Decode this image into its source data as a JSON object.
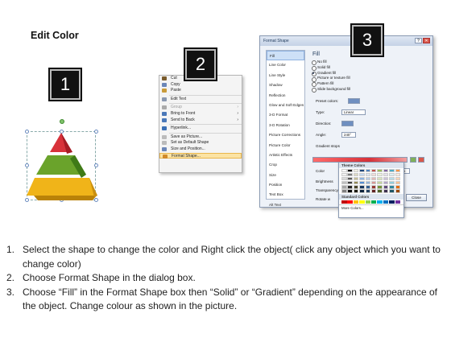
{
  "title": "Edit Color",
  "badges": [
    "1",
    "2",
    "3"
  ],
  "context_menu": {
    "items": [
      {
        "label": "Cut",
        "color": "#7a5c2e"
      },
      {
        "label": "Copy",
        "color": "#6b86b8"
      },
      {
        "label": "Paste",
        "color": "#c99b3a"
      },
      {
        "sep": true
      },
      {
        "label": "Edit Text",
        "color": "#8a98b0"
      },
      {
        "sep": true
      },
      {
        "label": "Group",
        "disabled": true,
        "arrow": true,
        "color": "#aaaaaa"
      },
      {
        "label": "Bring to Front",
        "arrow": true,
        "color": "#4a78b8"
      },
      {
        "label": "Send to Back",
        "arrow": true,
        "color": "#4a78b8"
      },
      {
        "sep": true
      },
      {
        "label": "Hyperlink...",
        "color": "#3a6fb5"
      },
      {
        "sep": true
      },
      {
        "label": "Save as Picture...",
        "color": "#bbbbbb"
      },
      {
        "label": "Set as Default Shape",
        "color": "#bbbbbb"
      },
      {
        "label": "Size and Position...",
        "color": "#6b86b8"
      },
      {
        "label": "Format Shape...",
        "highlight": true,
        "color": "#d08a2a"
      }
    ]
  },
  "dialog": {
    "title": "Format Shape",
    "sidebar": [
      "Fill",
      "Line Color",
      "Line Style",
      "Shadow",
      "Reflection",
      "Glow and Soft Edges",
      "3-D Format",
      "3-D Rotation",
      "Picture Corrections",
      "Picture Color",
      "Artistic Effects",
      "Crop",
      "Size",
      "Position",
      "Text Box",
      "Alt Text"
    ],
    "fill_heading": "Fill",
    "options": [
      {
        "label": "No fill",
        "on": false
      },
      {
        "label": "Solid fill",
        "on": false
      },
      {
        "label": "Gradient fill",
        "on": true
      },
      {
        "label": "Picture or texture fill",
        "on": false
      },
      {
        "label": "Pattern fill",
        "on": false
      },
      {
        "label": "Slide background fill",
        "on": false
      }
    ],
    "preset_label": "Preset colors:",
    "type_label": "Type:",
    "type_value": "Linear",
    "direction_label": "Direction:",
    "angle_label": "Angle:",
    "angle_value": "240°",
    "stops_label": "Gradient stops",
    "color_label": "Color",
    "position_label": "Position:",
    "position_value": "100%",
    "brightness_label": "Brightness",
    "transparency_label": "Transparency",
    "rotate_label": "Rotate w",
    "close_label": "Close"
  },
  "palette": {
    "theme_heading": "Theme Colors",
    "theme_rows": [
      [
        "#ffffff",
        "#000000",
        "#eeece1",
        "#1f497d",
        "#4f81bd",
        "#c0504d",
        "#9bbb59",
        "#8064a2",
        "#4bacc6",
        "#f79646"
      ],
      [
        "#f2f2f2",
        "#7f7f7f",
        "#ddd9c3",
        "#c6d9f0",
        "#dbe5f1",
        "#f2dcdb",
        "#ebf1dd",
        "#e5e0ec",
        "#dbeef3",
        "#fdeada"
      ],
      [
        "#d8d8d8",
        "#595959",
        "#c4bd97",
        "#8db3e2",
        "#b8cce4",
        "#e5b9b7",
        "#d7e3bc",
        "#ccc1d9",
        "#b7dde8",
        "#fbd5b5"
      ],
      [
        "#bfbfbf",
        "#3f3f3f",
        "#938953",
        "#548dd4",
        "#95b3d7",
        "#d99694",
        "#c3d69b",
        "#b2a2c7",
        "#92cddc",
        "#fac08f"
      ],
      [
        "#a5a5a5",
        "#262626",
        "#494429",
        "#17365d",
        "#366092",
        "#953734",
        "#76923c",
        "#5f497a",
        "#31859b",
        "#e36c09"
      ],
      [
        "#7f7f7f",
        "#0c0c0c",
        "#1d1b10",
        "#0f243e",
        "#244061",
        "#632423",
        "#4f6128",
        "#3f3151",
        "#205867",
        "#974806"
      ]
    ],
    "standard_heading": "Standard Colors",
    "standard": [
      "#c00000",
      "#ff0000",
      "#ffc000",
      "#ffff00",
      "#92d050",
      "#00b050",
      "#00b0f0",
      "#0070c0",
      "#002060",
      "#7030a0"
    ],
    "more_label": "More Colors..."
  },
  "pyramid_colors": {
    "top": "#d8323a",
    "middle": "#6aa32b",
    "bottom": "#f0b419"
  },
  "steps": [
    {
      "n": "1.",
      "text": "Select the shape to change the color and Right click the object( click any object which you want to change color)"
    },
    {
      "n": "2.",
      "text": "Choose Format Shape in the dialog box."
    },
    {
      "n": "3.",
      "text": "Choose “Fill” in the Format Shape box then “Solid” or “Gradient” depending on the appearance of the object. Change colour as shown in the picture."
    }
  ]
}
